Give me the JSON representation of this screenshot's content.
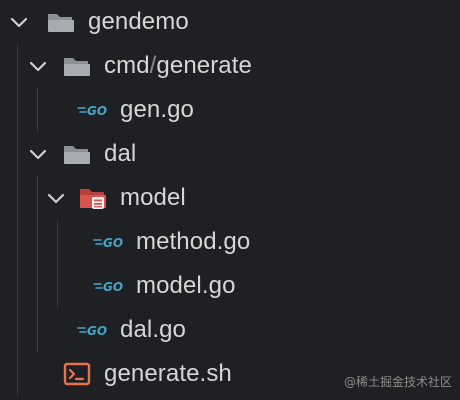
{
  "colors": {
    "background": "#1f2023",
    "text": "#d6d6d6",
    "folder": "#9aa0a6",
    "model_folder": "#d9534f",
    "go_icon": "#42a5c8",
    "shell_icon": "#e8744c",
    "guide": "#3b3c40"
  },
  "tree": {
    "root": {
      "label": "gendemo",
      "icon": "folder-open-icon"
    },
    "cmd": {
      "label_a": "cmd",
      "label_sep": "/",
      "label_b": "generate",
      "icon": "folder-open-icon"
    },
    "gen": {
      "label": "gen.go",
      "icon": "go-file-icon"
    },
    "dal": {
      "label": "dal",
      "icon": "folder-open-icon"
    },
    "model": {
      "label": "model",
      "icon": "database-folder-icon"
    },
    "method": {
      "label": "method.go",
      "icon": "go-file-icon"
    },
    "modelgo": {
      "label": "model.go",
      "icon": "go-file-icon"
    },
    "dalgo": {
      "label": "dal.go",
      "icon": "go-file-icon"
    },
    "generate_sh": {
      "label": "generate.sh",
      "icon": "terminal-file-icon"
    }
  },
  "watermark": "@稀土掘金技术社区"
}
